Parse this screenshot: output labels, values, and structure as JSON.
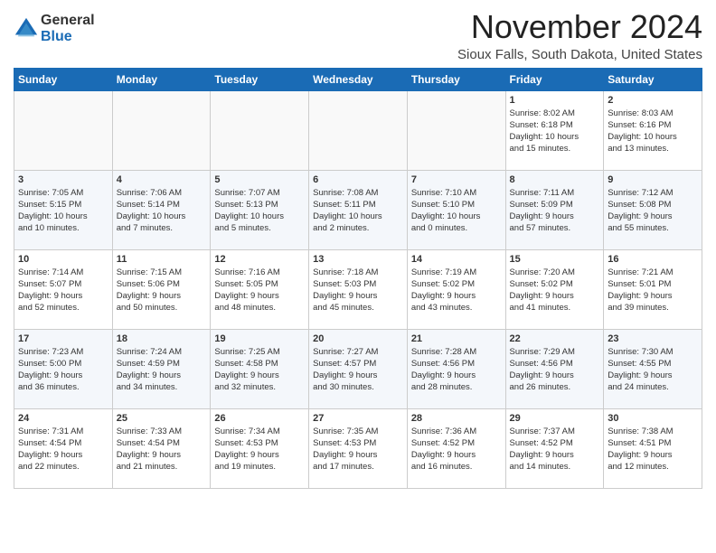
{
  "header": {
    "logo_general": "General",
    "logo_blue": "Blue",
    "month_title": "November 2024",
    "location": "Sioux Falls, South Dakota, United States"
  },
  "weekdays": [
    "Sunday",
    "Monday",
    "Tuesday",
    "Wednesday",
    "Thursday",
    "Friday",
    "Saturday"
  ],
  "weeks": [
    [
      {
        "day": "",
        "info": ""
      },
      {
        "day": "",
        "info": ""
      },
      {
        "day": "",
        "info": ""
      },
      {
        "day": "",
        "info": ""
      },
      {
        "day": "",
        "info": ""
      },
      {
        "day": "1",
        "info": "Sunrise: 8:02 AM\nSunset: 6:18 PM\nDaylight: 10 hours\nand 15 minutes."
      },
      {
        "day": "2",
        "info": "Sunrise: 8:03 AM\nSunset: 6:16 PM\nDaylight: 10 hours\nand 13 minutes."
      }
    ],
    [
      {
        "day": "3",
        "info": "Sunrise: 7:05 AM\nSunset: 5:15 PM\nDaylight: 10 hours\nand 10 minutes."
      },
      {
        "day": "4",
        "info": "Sunrise: 7:06 AM\nSunset: 5:14 PM\nDaylight: 10 hours\nand 7 minutes."
      },
      {
        "day": "5",
        "info": "Sunrise: 7:07 AM\nSunset: 5:13 PM\nDaylight: 10 hours\nand 5 minutes."
      },
      {
        "day": "6",
        "info": "Sunrise: 7:08 AM\nSunset: 5:11 PM\nDaylight: 10 hours\nand 2 minutes."
      },
      {
        "day": "7",
        "info": "Sunrise: 7:10 AM\nSunset: 5:10 PM\nDaylight: 10 hours\nand 0 minutes."
      },
      {
        "day": "8",
        "info": "Sunrise: 7:11 AM\nSunset: 5:09 PM\nDaylight: 9 hours\nand 57 minutes."
      },
      {
        "day": "9",
        "info": "Sunrise: 7:12 AM\nSunset: 5:08 PM\nDaylight: 9 hours\nand 55 minutes."
      }
    ],
    [
      {
        "day": "10",
        "info": "Sunrise: 7:14 AM\nSunset: 5:07 PM\nDaylight: 9 hours\nand 52 minutes."
      },
      {
        "day": "11",
        "info": "Sunrise: 7:15 AM\nSunset: 5:06 PM\nDaylight: 9 hours\nand 50 minutes."
      },
      {
        "day": "12",
        "info": "Sunrise: 7:16 AM\nSunset: 5:05 PM\nDaylight: 9 hours\nand 48 minutes."
      },
      {
        "day": "13",
        "info": "Sunrise: 7:18 AM\nSunset: 5:03 PM\nDaylight: 9 hours\nand 45 minutes."
      },
      {
        "day": "14",
        "info": "Sunrise: 7:19 AM\nSunset: 5:02 PM\nDaylight: 9 hours\nand 43 minutes."
      },
      {
        "day": "15",
        "info": "Sunrise: 7:20 AM\nSunset: 5:02 PM\nDaylight: 9 hours\nand 41 minutes."
      },
      {
        "day": "16",
        "info": "Sunrise: 7:21 AM\nSunset: 5:01 PM\nDaylight: 9 hours\nand 39 minutes."
      }
    ],
    [
      {
        "day": "17",
        "info": "Sunrise: 7:23 AM\nSunset: 5:00 PM\nDaylight: 9 hours\nand 36 minutes."
      },
      {
        "day": "18",
        "info": "Sunrise: 7:24 AM\nSunset: 4:59 PM\nDaylight: 9 hours\nand 34 minutes."
      },
      {
        "day": "19",
        "info": "Sunrise: 7:25 AM\nSunset: 4:58 PM\nDaylight: 9 hours\nand 32 minutes."
      },
      {
        "day": "20",
        "info": "Sunrise: 7:27 AM\nSunset: 4:57 PM\nDaylight: 9 hours\nand 30 minutes."
      },
      {
        "day": "21",
        "info": "Sunrise: 7:28 AM\nSunset: 4:56 PM\nDaylight: 9 hours\nand 28 minutes."
      },
      {
        "day": "22",
        "info": "Sunrise: 7:29 AM\nSunset: 4:56 PM\nDaylight: 9 hours\nand 26 minutes."
      },
      {
        "day": "23",
        "info": "Sunrise: 7:30 AM\nSunset: 4:55 PM\nDaylight: 9 hours\nand 24 minutes."
      }
    ],
    [
      {
        "day": "24",
        "info": "Sunrise: 7:31 AM\nSunset: 4:54 PM\nDaylight: 9 hours\nand 22 minutes."
      },
      {
        "day": "25",
        "info": "Sunrise: 7:33 AM\nSunset: 4:54 PM\nDaylight: 9 hours\nand 21 minutes."
      },
      {
        "day": "26",
        "info": "Sunrise: 7:34 AM\nSunset: 4:53 PM\nDaylight: 9 hours\nand 19 minutes."
      },
      {
        "day": "27",
        "info": "Sunrise: 7:35 AM\nSunset: 4:53 PM\nDaylight: 9 hours\nand 17 minutes."
      },
      {
        "day": "28",
        "info": "Sunrise: 7:36 AM\nSunset: 4:52 PM\nDaylight: 9 hours\nand 16 minutes."
      },
      {
        "day": "29",
        "info": "Sunrise: 7:37 AM\nSunset: 4:52 PM\nDaylight: 9 hours\nand 14 minutes."
      },
      {
        "day": "30",
        "info": "Sunrise: 7:38 AM\nSunset: 4:51 PM\nDaylight: 9 hours\nand 12 minutes."
      }
    ]
  ]
}
